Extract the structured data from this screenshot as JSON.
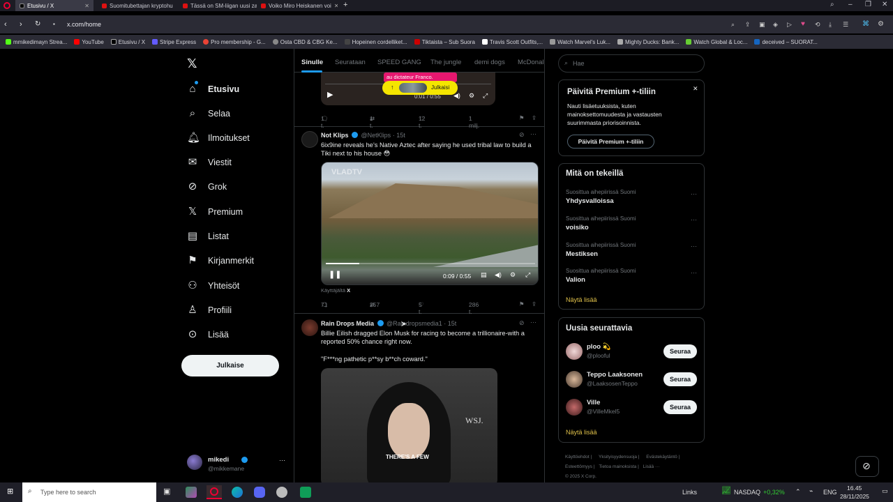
{
  "browser": {
    "tabs": [
      {
        "label": "Etusivu / X",
        "active": true
      },
      {
        "label": "Suomitubettajan kryptohu",
        "active": false
      },
      {
        "label": "Tässä on SM-liigan uusi za",
        "active": false
      },
      {
        "label": "Voiko Miro Heiskanen voi",
        "active": false
      }
    ],
    "url": "x.com/home",
    "bookmarks": [
      "mmikedimayn Strea...",
      "YouTube",
      "Etusivu / X",
      "Stripe Express",
      "Pro membership - G...",
      "Osta CBD & CBG Ke...",
      "Hopeinen cordelliket...",
      "Tiktaista – Sub Suora",
      "Travis Scott Outfits,...",
      "Watch Marvel's Luk...",
      "Mighty Ducks: Bank...",
      "Watch Global & Loc...",
      "deceived – SUORAT..."
    ]
  },
  "nav": {
    "items": [
      "Etusivu",
      "Selaa",
      "Ilmoitukset",
      "Viestit",
      "Grok",
      "Premium",
      "Listat",
      "Kirjanmerkit",
      "Yhteisöt",
      "Profiili",
      "Lisää"
    ],
    "post_button": "Julkaise",
    "account": {
      "name": "mikedi",
      "handle": "@mikkemane"
    }
  },
  "feed": {
    "tabs": [
      "Sinulle",
      "Seurataan",
      "SPEED GANG",
      "The jungle",
      "demi dogs",
      "McDonal"
    ],
    "tweet0": {
      "banner": "au dictateur Franco.",
      "live_badge": "Julkaisi",
      "time": "0:01 / 0:55",
      "actions": {
        "reply": "1 t.",
        "retweet": "1 t.",
        "like": "12 t.",
        "views": "1 milj."
      }
    },
    "tweet1": {
      "name": "Not Klips",
      "handle": "@NetKlips",
      "age": "15t",
      "text": "6ix9ine reveals he's Native Aztec after saying he used tribal law to build a Tiki next to his house 😳",
      "video_watermark": "VLADTV",
      "time": "0:09 / 0:55",
      "video_progress": 0.16,
      "source": "Käyttäjältä",
      "source_icon": "X",
      "actions": {
        "reply": "71",
        "retweet": "257",
        "like": "5 t.",
        "views": "286 t."
      }
    },
    "tweet2": {
      "name": "Rain Drops Media",
      "handle": "@Raindropsmedia1",
      "age": "15t",
      "text": "Billie Eilish dragged Elon Musk for racing to become a trillionaire-with a reported 50% chance right now.",
      "quote": "\"F***ng pathetic p**sy b**ch coward.\"",
      "wsj": "WSJ.",
      "caption": "THERE'S A FEW"
    }
  },
  "right": {
    "search_placeholder": "Hae",
    "premium": {
      "title": "Päivitä Premium +-tiliin",
      "text": "Nauti lisäetuuksista, kuten mainoksettomuudesta ja vastausten suurimmasta priorisoinnista.",
      "button": "Päivitä Premium +-tiliin"
    },
    "trends_title": "Mitä on tekeillä",
    "trends": [
      {
        "context": "Suosittua aihepiirissä Suomi",
        "name": "Yhdysvalloissa"
      },
      {
        "context": "Suosittua aihepiirissä Suomi",
        "name": "voisiko"
      },
      {
        "context": "Suosittua aihepiirissä Suomi",
        "name": "Mestiksen"
      },
      {
        "context": "Suosittua aihepiirissä Suomi",
        "name": "Valion"
      }
    ],
    "show_more": "Näytä lisää",
    "follow_title": "Uusia seurattavia",
    "suggestions": [
      {
        "name": "ploo 💫",
        "handle": "@plooful",
        "button": "Seuraa"
      },
      {
        "name": "Teppo Laaksonen",
        "handle": "@LaaksosenTeppo",
        "button": "Seuraa"
      },
      {
        "name": "Ville",
        "handle": "@VilleMkel5",
        "button": "Seuraa"
      }
    ],
    "show_more2": "Näytä lisää",
    "footer": [
      "Käyttöehdot",
      "Yksityisyydensuoja",
      "Evästekäytäntö",
      "Esteettömyys",
      "Tietoa mainoksista",
      "Lisää ···",
      "© 2025 X Corp."
    ]
  },
  "taskbar": {
    "search_placeholder": "Type here to search",
    "links": "Links",
    "ticker": "NASDAQ",
    "ticker_change": "+0,32%",
    "lang": "ENG",
    "time": "16.45",
    "date": "28/11/2025"
  }
}
